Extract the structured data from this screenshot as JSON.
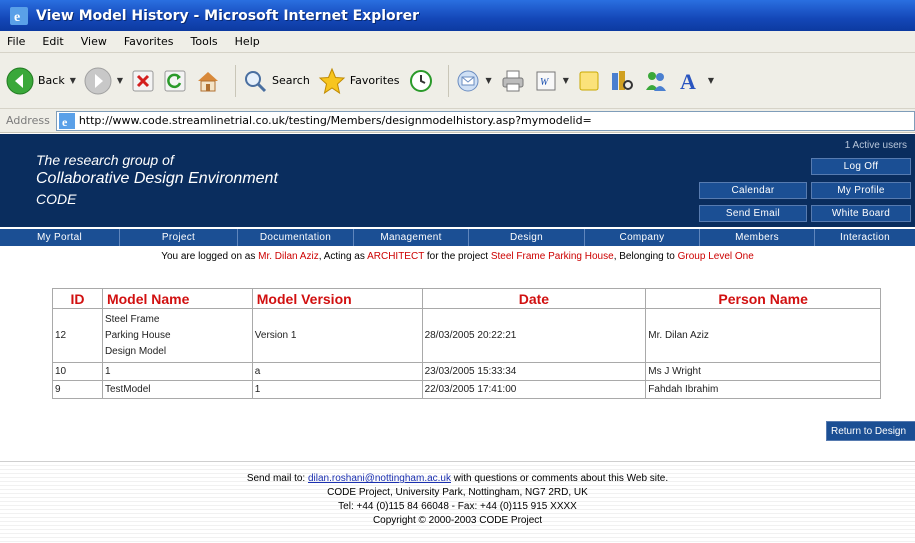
{
  "window": {
    "title": "View Model History - Microsoft Internet Explorer"
  },
  "menu": [
    "File",
    "Edit",
    "View",
    "Favorites",
    "Tools",
    "Help"
  ],
  "toolbar": {
    "back_label": "Back",
    "search_label": "Search",
    "favorites_label": "Favorites"
  },
  "address": {
    "label": "Address",
    "url": "http://www.code.streamlinetrial.co.uk/testing/Members/designmodelhistory.asp?mymodelid="
  },
  "header": {
    "brand_line1": "The research group of",
    "brand_line2": "Collaborative Design Environment",
    "brand_line3": "CODE",
    "active_users": "1 Active users",
    "buttons": {
      "logoff": "Log Off",
      "calendar": "Calendar",
      "profile": "My Profile",
      "email": "Send Email",
      "whiteboard": "White Board"
    }
  },
  "nav": [
    "My Portal",
    "Project",
    "Documentation",
    "Management",
    "Design",
    "Company",
    "Members",
    "Interaction"
  ],
  "logged": {
    "prefix": "You are logged on as",
    "user": "Mr. Dilan Aziz",
    "acting": ", Acting as",
    "role": "ARCHITECT",
    "for_project": "for the project",
    "project": "Steel Frame Parking House",
    "belonging": ", Belonging to",
    "group": "Group Level One"
  },
  "table": {
    "headers": [
      "ID",
      "Model Name",
      "Model Version",
      "Date",
      "Person Name"
    ],
    "rows": [
      {
        "id": "12",
        "name_lines": [
          "Steel Frame",
          "Parking House",
          "Design Model"
        ],
        "version": "Version 1",
        "date": "28/03/2005 20:22:21",
        "person": "Mr. Dilan Aziz"
      },
      {
        "id": "10",
        "name": "1",
        "version": "a",
        "date": "23/03/2005 15:33:34",
        "person": "Ms J Wright"
      },
      {
        "id": "9",
        "name": "TestModel",
        "version": "1",
        "date": "22/03/2005 17:41:00",
        "person": "Fahdah Ibrahim"
      }
    ]
  },
  "return_button": "Return to Design",
  "footer": {
    "mail_prefix": "Send mail to:",
    "mail_link": "dilan.roshani@nottingham.ac.uk",
    "mail_suffix": "with questions or comments about this Web site.",
    "address": "CODE Project, University Park, Nottingham, NG7 2RD, UK",
    "phone": "Tel: +44 (0)115 84 66048 - Fax: +44 (0)115 915 XXXX",
    "copyright": "Copyright © 2000-2003 CODE Project"
  }
}
